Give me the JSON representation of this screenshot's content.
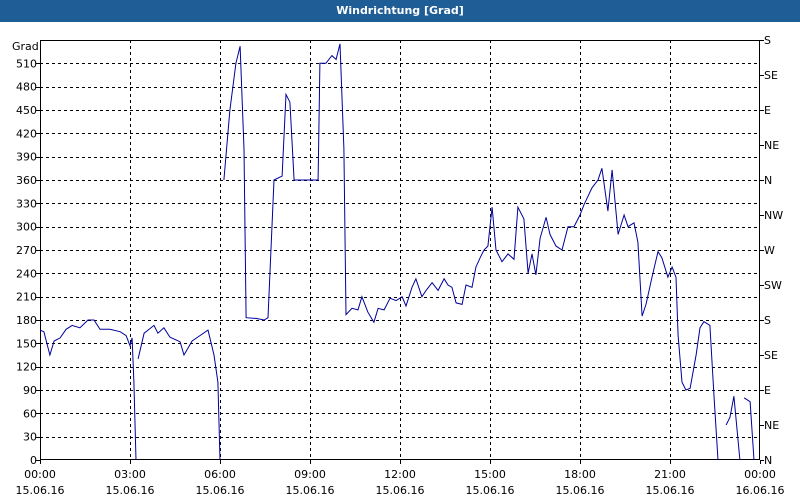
{
  "window": {
    "title": "Windrichtung [Grad]"
  },
  "chart_data": {
    "type": "line",
    "title": "Windrichtung [Grad]",
    "ylabel": "Grad",
    "ylim": [
      0,
      540
    ],
    "y_ticks": [
      0,
      30,
      60,
      90,
      120,
      150,
      180,
      210,
      240,
      270,
      300,
      330,
      360,
      390,
      420,
      450,
      480,
      510
    ],
    "x_range_hours": [
      0,
      24
    ],
    "x_ticks": [
      {
        "time": "00:00",
        "date": "15.06.16"
      },
      {
        "time": "03:00",
        "date": "15.06.16"
      },
      {
        "time": "06:00",
        "date": "15.06.16"
      },
      {
        "time": "09:00",
        "date": "15.06.16"
      },
      {
        "time": "12:00",
        "date": "15.06.16"
      },
      {
        "time": "15:00",
        "date": "15.06.16"
      },
      {
        "time": "18:00",
        "date": "15.06.16"
      },
      {
        "time": "21:00",
        "date": "15.06.16"
      },
      {
        "time": "00:00",
        "date": "16.06.16"
      }
    ],
    "right_axis": [
      {
        "label": "N",
        "value": 0
      },
      {
        "label": "NE",
        "value": 45
      },
      {
        "label": "E",
        "value": 90
      },
      {
        "label": "SE",
        "value": 135
      },
      {
        "label": "S",
        "value": 180
      },
      {
        "label": "SW",
        "value": 225
      },
      {
        "label": "W",
        "value": 270
      },
      {
        "label": "NW",
        "value": 315
      },
      {
        "label": "N",
        "value": 360
      },
      {
        "label": "NE",
        "value": 405
      },
      {
        "label": "E",
        "value": 450
      },
      {
        "label": "SE",
        "value": 495
      },
      {
        "label": "S",
        "value": 540
      }
    ],
    "grid": true,
    "series_color": "#00009c",
    "segments": [
      [
        [
          0.0,
          167
        ],
        [
          0.13,
          165
        ],
        [
          0.33,
          135
        ],
        [
          0.47,
          153
        ],
        [
          0.67,
          157
        ],
        [
          0.87,
          168
        ],
        [
          1.07,
          173
        ],
        [
          1.33,
          170
        ],
        [
          1.6,
          180
        ],
        [
          1.8,
          180
        ],
        [
          2.0,
          168
        ],
        [
          2.33,
          168
        ],
        [
          2.67,
          165
        ],
        [
          2.87,
          160
        ],
        [
          3.0,
          147
        ],
        [
          3.07,
          157
        ],
        [
          3.13,
          100
        ],
        [
          3.2,
          0
        ]
      ],
      [
        [
          3.27,
          130
        ],
        [
          3.47,
          163
        ],
        [
          3.6,
          167
        ],
        [
          3.8,
          173
        ],
        [
          3.93,
          163
        ],
        [
          4.13,
          170
        ],
        [
          4.33,
          158
        ],
        [
          4.67,
          152
        ],
        [
          4.8,
          135
        ],
        [
          5.07,
          153
        ],
        [
          5.33,
          160
        ],
        [
          5.6,
          167
        ],
        [
          5.8,
          135
        ],
        [
          5.93,
          100
        ],
        [
          6.0,
          0
        ]
      ],
      [
        [
          6.13,
          360
        ],
        [
          6.33,
          450
        ],
        [
          6.53,
          510
        ],
        [
          6.67,
          532
        ],
        [
          6.8,
          400
        ],
        [
          6.87,
          183
        ],
        [
          7.2,
          182
        ],
        [
          7.47,
          180
        ],
        [
          7.6,
          183
        ],
        [
          7.8,
          360
        ],
        [
          8.07,
          365
        ],
        [
          8.2,
          470
        ],
        [
          8.33,
          460
        ],
        [
          8.47,
          360
        ],
        [
          8.6,
          360
        ],
        [
          8.87,
          360
        ],
        [
          9.0,
          360
        ],
        [
          9.2,
          360
        ],
        [
          9.27,
          360
        ],
        [
          9.33,
          510
        ],
        [
          9.53,
          510
        ],
        [
          9.73,
          520
        ],
        [
          9.87,
          515
        ],
        [
          10.0,
          535
        ],
        [
          10.13,
          400
        ],
        [
          10.2,
          187
        ],
        [
          10.4,
          195
        ],
        [
          10.6,
          193
        ],
        [
          10.73,
          210
        ],
        [
          10.93,
          190
        ],
        [
          11.13,
          177
        ],
        [
          11.27,
          195
        ],
        [
          11.47,
          193
        ],
        [
          11.67,
          208
        ],
        [
          11.87,
          205
        ],
        [
          12.07,
          210
        ],
        [
          12.2,
          198
        ],
        [
          12.4,
          222
        ],
        [
          12.53,
          233
        ],
        [
          12.73,
          210
        ],
        [
          12.87,
          218
        ],
        [
          13.07,
          228
        ],
        [
          13.27,
          218
        ],
        [
          13.47,
          233
        ],
        [
          13.6,
          225
        ],
        [
          13.73,
          222
        ],
        [
          13.87,
          202
        ],
        [
          14.07,
          200
        ],
        [
          14.2,
          225
        ],
        [
          14.4,
          222
        ],
        [
          14.53,
          248
        ],
        [
          14.67,
          260
        ],
        [
          14.8,
          270
        ],
        [
          14.93,
          275
        ],
        [
          15.07,
          325
        ],
        [
          15.2,
          270
        ],
        [
          15.4,
          255
        ],
        [
          15.6,
          265
        ],
        [
          15.8,
          258
        ],
        [
          15.93,
          325
        ],
        [
          16.13,
          310
        ],
        [
          16.27,
          240
        ],
        [
          16.4,
          265
        ],
        [
          16.53,
          238
        ],
        [
          16.67,
          285
        ],
        [
          16.87,
          312
        ],
        [
          17.0,
          290
        ],
        [
          17.2,
          275
        ],
        [
          17.4,
          270
        ],
        [
          17.6,
          300
        ],
        [
          17.8,
          300
        ],
        [
          18.0,
          315
        ],
        [
          18.13,
          328
        ],
        [
          18.4,
          350
        ],
        [
          18.6,
          360
        ],
        [
          18.73,
          375
        ],
        [
          18.93,
          320
        ],
        [
          19.07,
          373
        ],
        [
          19.27,
          290
        ],
        [
          19.47,
          315
        ],
        [
          19.6,
          300
        ],
        [
          19.8,
          305
        ],
        [
          19.93,
          280
        ],
        [
          20.07,
          185
        ],
        [
          20.2,
          200
        ],
        [
          20.4,
          235
        ],
        [
          20.6,
          268
        ],
        [
          20.73,
          260
        ],
        [
          20.93,
          235
        ],
        [
          21.07,
          248
        ],
        [
          21.2,
          235
        ],
        [
          21.27,
          160
        ],
        [
          21.4,
          100
        ],
        [
          21.53,
          90
        ],
        [
          21.67,
          92
        ],
        [
          21.87,
          135
        ],
        [
          22.0,
          170
        ],
        [
          22.13,
          178
        ],
        [
          22.33,
          173
        ],
        [
          22.47,
          80
        ],
        [
          22.6,
          0
        ]
      ],
      [
        [
          22.87,
          45
        ],
        [
          23.0,
          55
        ],
        [
          23.13,
          82
        ],
        [
          23.33,
          0
        ]
      ],
      [
        [
          23.47,
          80
        ],
        [
          23.67,
          75
        ],
        [
          23.8,
          0
        ]
      ]
    ]
  }
}
